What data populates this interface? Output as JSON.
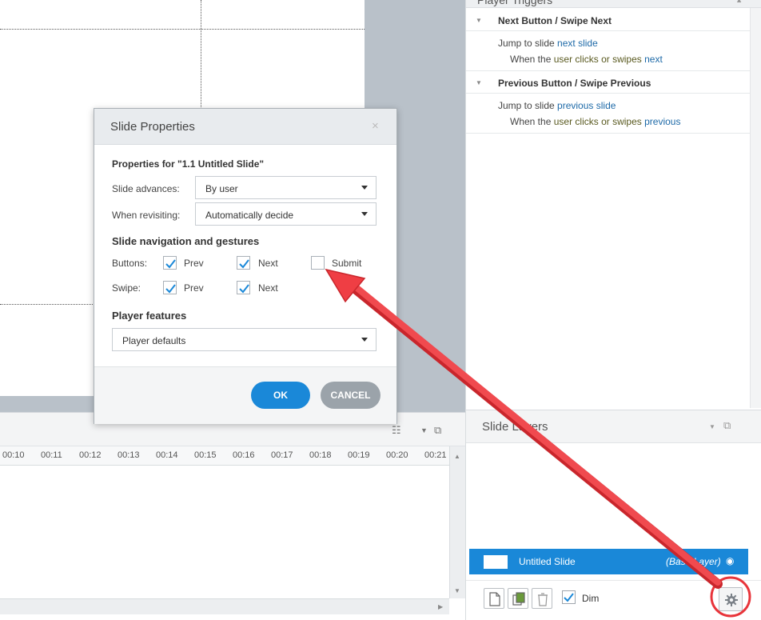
{
  "triggers": {
    "panel_title": "Player Triggers",
    "groups": [
      {
        "title": "Next Button / Swipe Next",
        "action_prefix": "Jump to slide",
        "action_target": "next slide",
        "cond_when": "When the",
        "cond_user": "user",
        "cond_mid": "clicks or swipes",
        "cond_target": "next"
      },
      {
        "title": "Previous Button / Swipe Previous",
        "action_prefix": "Jump to slide",
        "action_target": "previous slide",
        "cond_when": "When the",
        "cond_user": "user",
        "cond_mid": "clicks or swipes",
        "cond_target": "previous"
      }
    ]
  },
  "timeline": {
    "ticks": [
      "00:10",
      "00:11",
      "00:12",
      "00:13",
      "00:14",
      "00:15",
      "00:16",
      "00:17",
      "00:18",
      "00:19",
      "00:20",
      "00:21"
    ]
  },
  "layers": {
    "title": "Slide Layers",
    "row_name": "Untitled Slide",
    "row_tag": "(Base Layer)",
    "dim_label": "Dim",
    "dim_checked": true
  },
  "dialog": {
    "title": "Slide Properties",
    "close_glyph": "×",
    "heading": "Properties for \"1.1 Untitled Slide\"",
    "advances_label": "Slide advances:",
    "advances_value": "By user",
    "revisit_label": "When revisiting:",
    "revisit_value": "Automatically decide",
    "nav_heading": "Slide navigation and gestures",
    "buttons_label": "Buttons:",
    "swipe_label": "Swipe:",
    "prev_label": "Prev",
    "next_label": "Next",
    "submit_label": "Submit",
    "checks": {
      "buttons_prev": true,
      "buttons_next": true,
      "buttons_submit": false,
      "swipe_prev": true,
      "swipe_next": true
    },
    "player_heading": "Player features",
    "player_value": "Player defaults",
    "ok_label": "OK",
    "cancel_label": "CANCEL"
  },
  "colors": {
    "accent": "#1a88d8",
    "annotation": "#e8343a",
    "link": "#1e6aa8"
  }
}
